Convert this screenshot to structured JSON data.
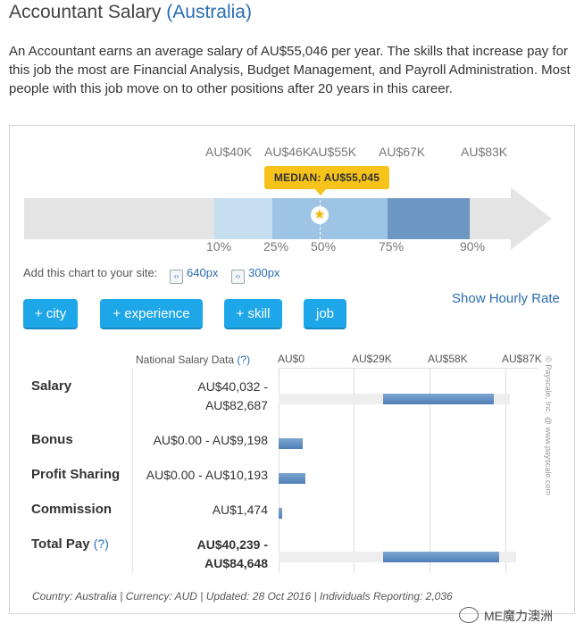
{
  "header": {
    "title": "Accountant Salary",
    "country": "(Australia)",
    "intro": "An Accountant earns an average salary of AU$55,046 per year. The skills that increase pay for this job the most are Financial Analysis, Budget Management, and Payroll Administration. Most people with this job move on to other positions after 20 years in this career."
  },
  "range_chart": {
    "values": [
      "AU$40K",
      "AU$46K",
      "AU$55K",
      "AU$67K",
      "AU$83K"
    ],
    "percentiles": [
      "10%",
      "25%",
      "50%",
      "75%",
      "90%"
    ],
    "median_label": "MEDIAN: AU$55,045",
    "band_colors": [
      "#c5def0",
      "#9dc4e4",
      "#6b97c2"
    ],
    "track_color": "#e4e4e4"
  },
  "embed": {
    "label": "Add this chart to your site:",
    "options": [
      "640px",
      "300px"
    ]
  },
  "filters": {
    "buttons": [
      "+ city",
      "+ experience",
      "+ skill",
      "job"
    ],
    "hourly_link": "Show Hourly Rate"
  },
  "table": {
    "header": "National Salary Data",
    "header_help": "(?)",
    "axis": [
      "AU$0",
      "AU$29K",
      "AU$58K",
      "AU$87K"
    ],
    "axis_max": 87,
    "rows": [
      {
        "label": "Salary",
        "line1": "AU$40,032 -",
        "line2": "AU$82,687",
        "min": 40.032,
        "max": 82.687
      },
      {
        "label": "Bonus",
        "line1": "AU$0.00 - AU$9,198",
        "min": 0,
        "max": 9.198
      },
      {
        "label": "Profit Sharing",
        "line1": "AU$0.00 - AU$10,193",
        "min": 0,
        "max": 10.193
      },
      {
        "label": "Commission",
        "line1": "AU$1,474",
        "min": 0,
        "max": 1.474
      },
      {
        "label": "Total Pay",
        "help": "(?)",
        "line1": "AU$40,239 -",
        "line2": "AU$84,648",
        "min": 40.239,
        "max": 84.648
      }
    ],
    "watermark": "© Payscale, Inc. @ www.payscale.com"
  },
  "footer": "Country: Australia | Currency: AUD | Updated: 28 Oct 2016 | Individuals Reporting: 2,036",
  "wechat_badge": "ME魔力澳洲"
}
